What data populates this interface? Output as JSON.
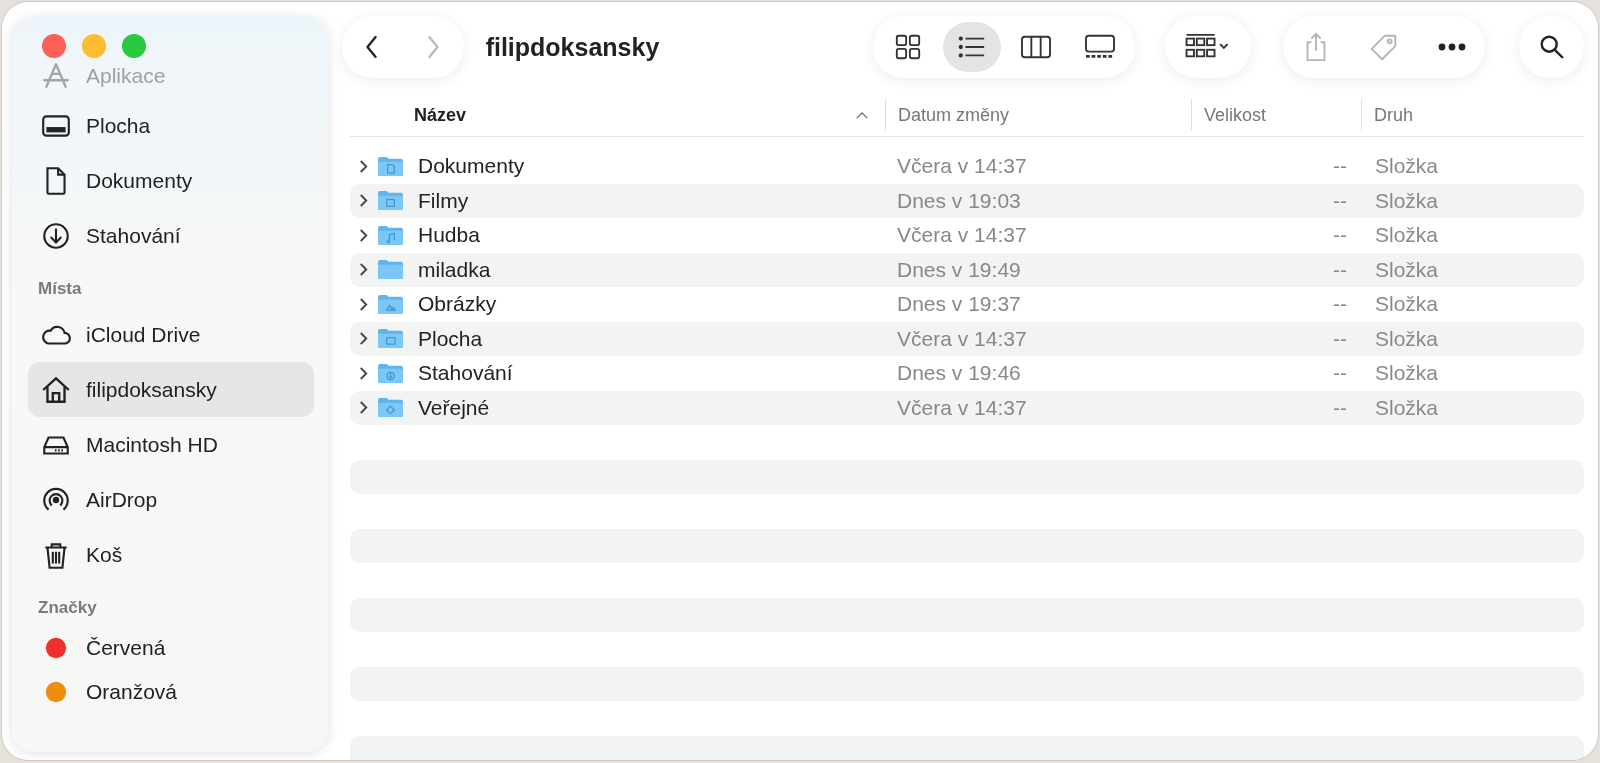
{
  "window": {
    "title": "filipdoksansky"
  },
  "toolbar": {
    "nav": [
      {
        "kind": "back",
        "disabled": false
      },
      {
        "kind": "forward",
        "disabled": true
      }
    ],
    "view_modes": [
      {
        "kind": "icons",
        "selected": false
      },
      {
        "kind": "list",
        "selected": true
      },
      {
        "kind": "columns",
        "selected": false
      },
      {
        "kind": "gallery",
        "selected": false
      }
    ],
    "actions": [
      {
        "kind": "share",
        "disabled": true
      },
      {
        "kind": "tag",
        "disabled": true
      },
      {
        "kind": "more",
        "disabled": false
      }
    ]
  },
  "sidebar": {
    "favorites": [
      {
        "label": "Aplikace",
        "kind": "apps",
        "selected": false
      },
      {
        "label": "Plocha",
        "kind": "desktop",
        "selected": false
      },
      {
        "label": "Dokumenty",
        "kind": "document",
        "selected": false
      },
      {
        "label": "Stahování",
        "kind": "download",
        "selected": false
      }
    ],
    "sections": [
      {
        "title": "Místa",
        "items": [
          {
            "label": "iCloud Drive",
            "kind": "cloud",
            "selected": false
          },
          {
            "label": "filipdoksansky",
            "kind": "home",
            "selected": true
          },
          {
            "label": "Macintosh HD",
            "kind": "disk",
            "selected": false
          },
          {
            "label": "AirDrop",
            "kind": "airdrop",
            "selected": false
          },
          {
            "label": "Koš",
            "kind": "trash",
            "selected": false
          }
        ]
      },
      {
        "title": "Značky",
        "items": [
          {
            "label": "Červená",
            "kind": "tag",
            "color": "#f0302a",
            "selected": false
          },
          {
            "label": "Oranžová",
            "kind": "tag",
            "color": "#f08c0a",
            "selected": false
          }
        ]
      }
    ]
  },
  "table": {
    "columns": [
      {
        "label": "Název",
        "sorted": true
      },
      {
        "label": "Datum změny",
        "sorted": false
      },
      {
        "label": "Velikost",
        "sorted": false
      },
      {
        "label": "Druh",
        "sorted": false
      }
    ],
    "rows": [
      {
        "name": "Dokumenty",
        "kind": "documents",
        "expanded": false,
        "modified": "Včera v 14:37",
        "size": "--",
        "type": "Složka"
      },
      {
        "name": "Filmy",
        "kind": "movies",
        "expanded": false,
        "modified": "Dnes v 19:03",
        "size": "--",
        "type": "Složka"
      },
      {
        "name": "Hudba",
        "kind": "music",
        "expanded": false,
        "modified": "Včera v 14:37",
        "size": "--",
        "type": "Složka"
      },
      {
        "name": "miladka",
        "kind": "plain",
        "expanded": false,
        "modified": "Dnes v 19:49",
        "size": "--",
        "type": "Složka"
      },
      {
        "name": "Obrázky",
        "kind": "pictures",
        "expanded": false,
        "modified": "Dnes v 19:37",
        "size": "--",
        "type": "Složka"
      },
      {
        "name": "Plocha",
        "kind": "desktop",
        "expanded": false,
        "modified": "Včera v 14:37",
        "size": "--",
        "type": "Složka"
      },
      {
        "name": "Stahování",
        "kind": "downloads",
        "expanded": false,
        "modified": "Dnes v 19:46",
        "size": "--",
        "type": "Složka"
      },
      {
        "name": "Veřejné",
        "kind": "public",
        "expanded": false,
        "modified": "Včera v 14:37",
        "size": "--",
        "type": "Složka"
      }
    ]
  }
}
